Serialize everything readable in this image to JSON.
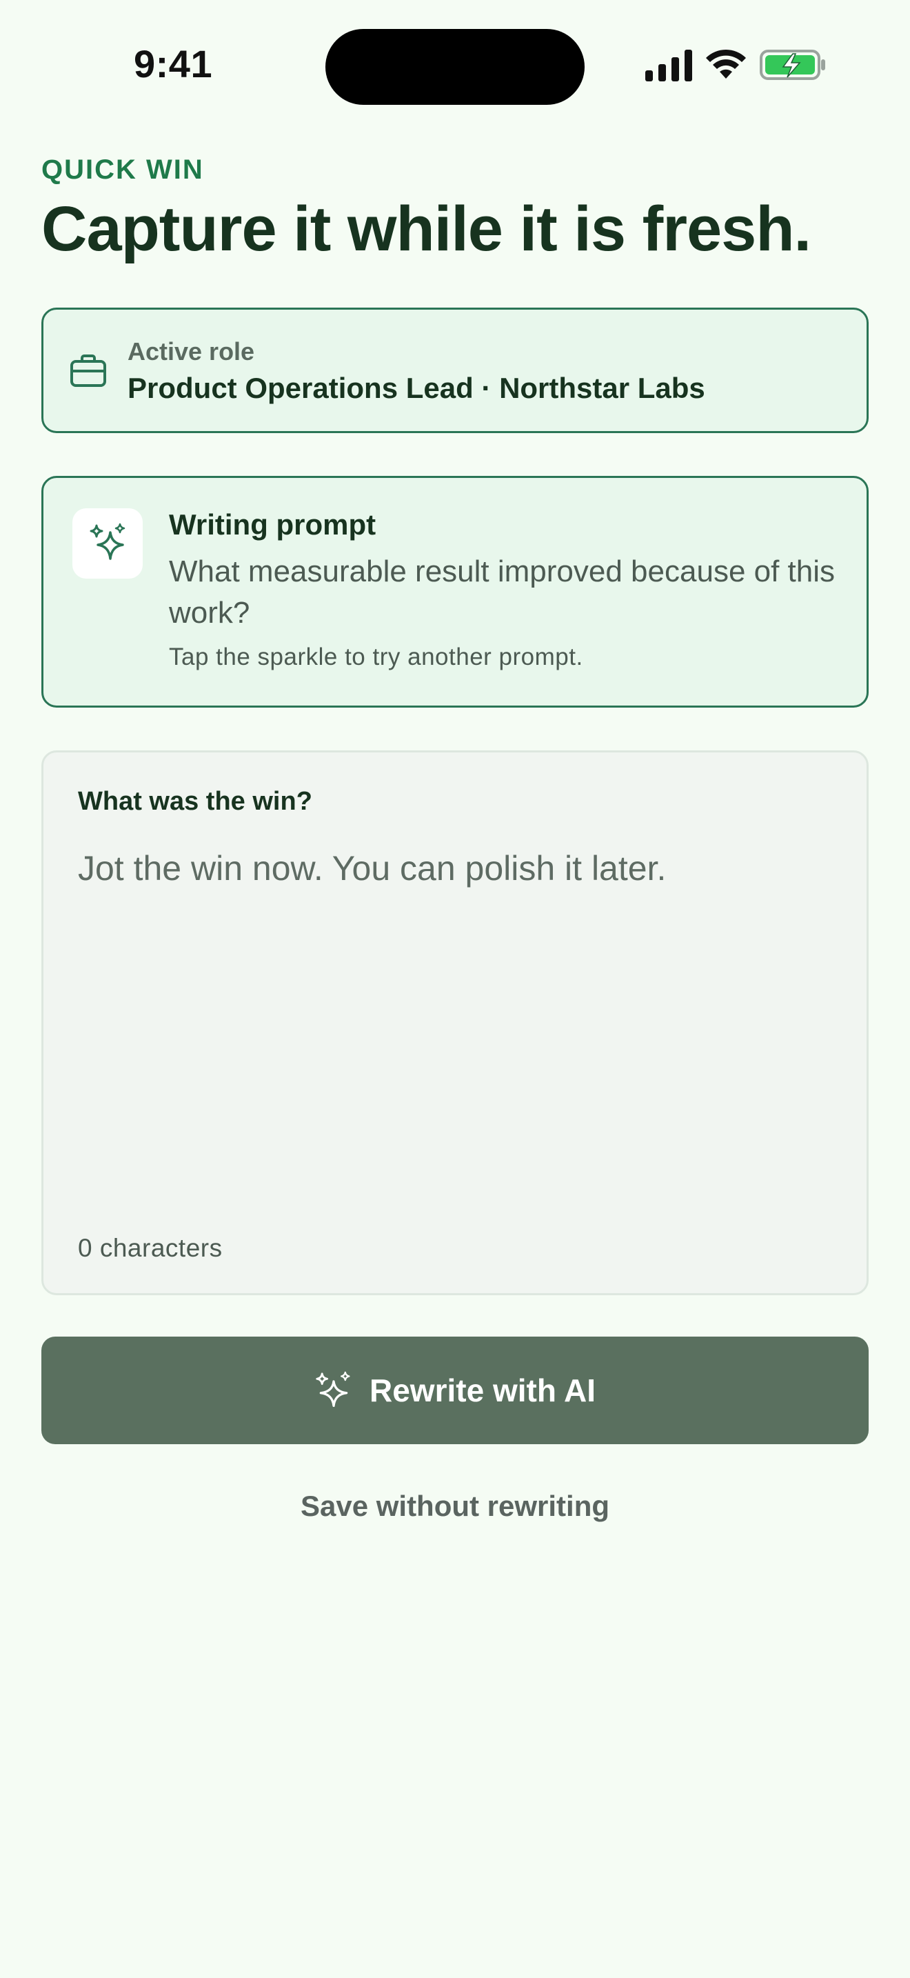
{
  "status_bar": {
    "time": "9:41",
    "icons": [
      "cellular-signal-icon",
      "wifi-icon",
      "battery-charging-icon"
    ]
  },
  "header": {
    "eyebrow": "QUICK WIN",
    "title": "Capture it while it is fresh."
  },
  "role_card": {
    "icon": "briefcase-icon",
    "label": "Active role",
    "value": "Product Operations Lead · Northstar Labs"
  },
  "prompt_card": {
    "icon": "sparkle-icon",
    "title": "Writing prompt",
    "text": "What measurable result improved because of this work?",
    "hint": "Tap the sparkle to try another prompt."
  },
  "entry": {
    "label": "What was the win?",
    "value": "",
    "placeholder": "Jot the win now. You can polish it later.",
    "char_count": "0 characters"
  },
  "actions": {
    "rewrite_icon": "sparkle-icon",
    "rewrite_label": "Rewrite with AI",
    "save_label": "Save without rewriting"
  },
  "colors": {
    "background": "#F5FCF4",
    "accent": "#1F7A4A",
    "card_border": "#2A7556",
    "card_fill": "#E8F7EC",
    "primary_button": "#5A705F",
    "battery_green": "#34C759"
  }
}
